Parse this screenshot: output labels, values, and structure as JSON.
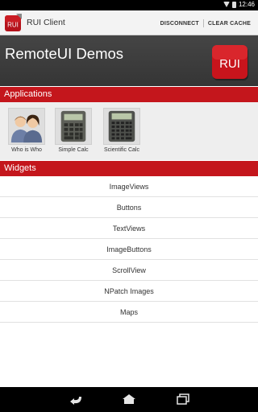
{
  "status_bar": {
    "time": "12:46"
  },
  "action_bar": {
    "title": "RUI Client",
    "actions": [
      "DISCONNECT",
      "CLEAR CACHE"
    ]
  },
  "hero": {
    "title": "RemoteUI Demos",
    "logo_text": "RUI"
  },
  "applications": {
    "header": "Applications",
    "items": [
      {
        "label": "Who is Who",
        "icon": "people-icon"
      },
      {
        "label": "Simple Calc",
        "icon": "calculator-icon"
      },
      {
        "label": "Scientific Calc",
        "icon": "scientific-calculator-icon"
      }
    ]
  },
  "widgets": {
    "header": "Widgets",
    "items": [
      "ImageViews",
      "Buttons",
      "TextViews",
      "ImageButtons",
      "ScrollView",
      "NPatch Images",
      "Maps"
    ]
  },
  "colors": {
    "accent": "#c4161c",
    "hero_bg": "#3d3d3d",
    "action_bar_bg": "#f3f3f3"
  },
  "nav_bar": {
    "buttons": [
      "back-icon",
      "home-icon",
      "recent-apps-icon"
    ]
  }
}
